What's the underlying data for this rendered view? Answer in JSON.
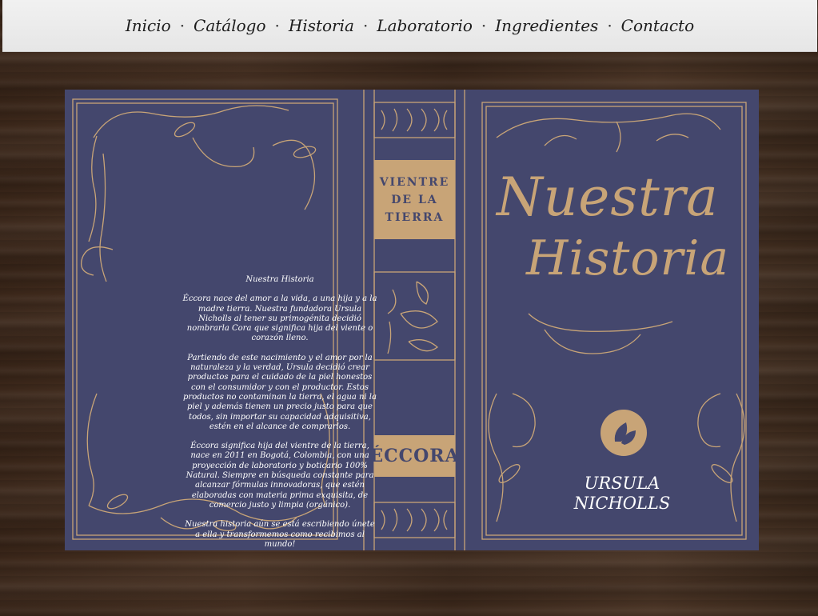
{
  "nav": {
    "items": [
      "Inicio",
      "Catálogo",
      "Historia",
      "Laboratorio",
      "Ingredientes",
      "Contacto"
    ],
    "separator": "·"
  },
  "book": {
    "back": {
      "heading": "Nuestra Historia",
      "paragraphs": [
        "Éccora nace del amor a la vida, a una hija y a la madre tierra. Nuestra fundadora Ursula Nicholls al tener su primogénita decidió nombrarla Cora que significa hija del viente o corazón lleno.",
        "Partiendo de este nacimiento y el amor por la naturaleza y la verdad, Ursula decidió crear productos para el cuidado de la piel honestos con el consumidor y con el productor. Estos productos  no contaminan la tierra, el agua ni la piel y además tienen un precio justo para que todos, sin importar su capacidad adquisitiva, estén en el alcance de comprarlos.",
        "Éccora significa hija del vientre de la tierra, nace en 2011 en Bogotá, Colombia, con una proyección de laboratorio y boticario 100% Natural. Siempre en búsqueda constante para alcanzar fórmulas  innovadoras, que estén elaboradas con materia prima exquisita, de comercio justo y limpia (orgánico).",
        "Nuestra historia aún se está escribiendo únete a ella y transformemos como recibimos al mundo!"
      ]
    },
    "spine": {
      "title_lines": [
        "VIENTRE",
        "DE LA",
        "TIERRA"
      ],
      "logo": "ÉCCORA"
    },
    "front": {
      "title_line1": "Nuestra",
      "title_line2": "Historia",
      "author_line1": "URSULA",
      "author_line2": "NICHOLLS",
      "emblem_icon": "leaf-icon"
    },
    "colors": {
      "cover": "#44476d",
      "gold": "#c8a477",
      "text": "#ffffff"
    }
  }
}
